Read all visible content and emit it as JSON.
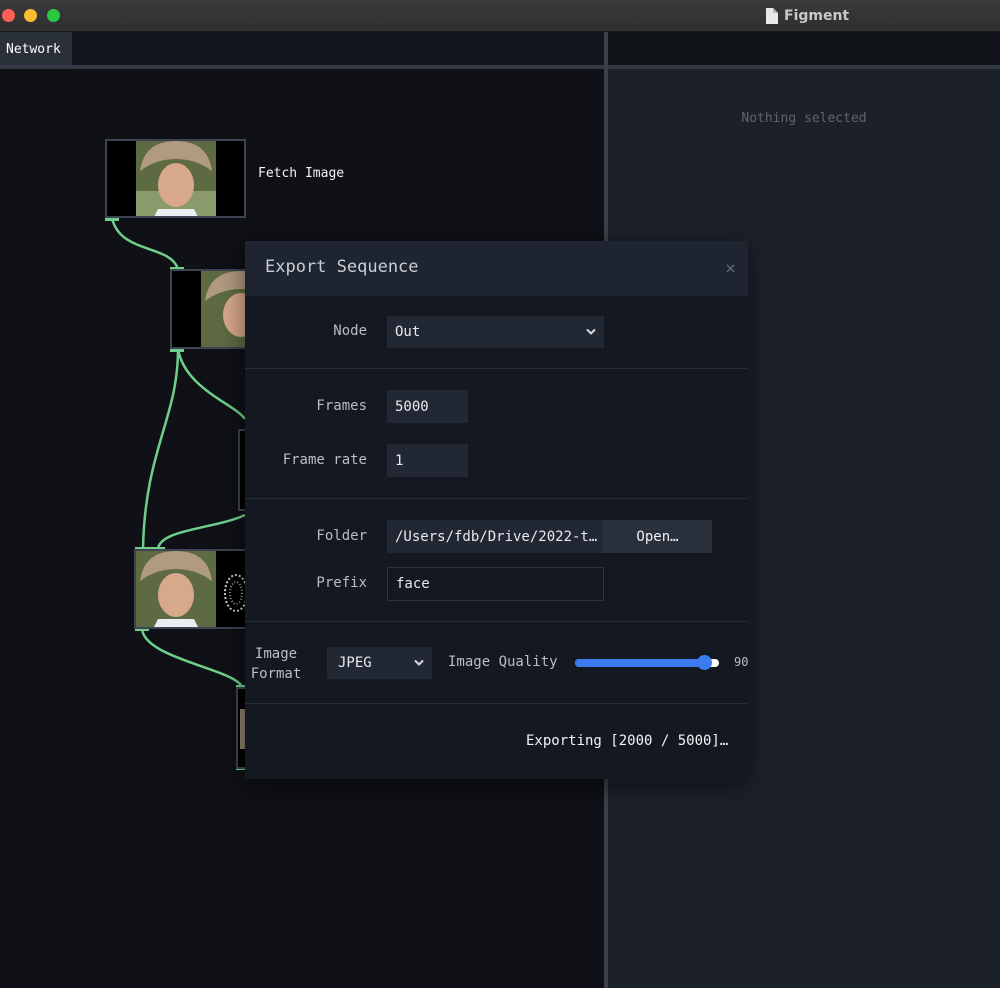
{
  "window": {
    "app_title": "Figment"
  },
  "network_tab": {
    "label": "Network"
  },
  "params_panel": {
    "empty_message": "Nothing selected"
  },
  "nodes": {
    "fetch_label": "Fetch Image"
  },
  "dialog": {
    "title": "Export Sequence",
    "close_glyph": "×",
    "node_label": "Node",
    "node_value": "Out",
    "frames_label": "Frames",
    "frames_value": "5000",
    "frame_rate_label": "Frame rate",
    "frame_rate_value": "1",
    "folder_label": "Folder",
    "folder_value": "/Users/fdb/Drive/2022-t…",
    "open_button": "Open…",
    "prefix_label": "Prefix",
    "prefix_value": "face",
    "image_format_label_line1": "Image",
    "image_format_label_line2": "Format",
    "image_format_value": "JPEG",
    "image_quality_label": "Image Quality",
    "image_quality_value": "90",
    "image_quality_fraction": 0.9,
    "status": "Exporting [2000 / 5000]…"
  },
  "colors": {
    "accent": "#3b7bef",
    "wire": "#6fcf8a",
    "panel_bg": "#1c2028",
    "canvas_bg": "#0f1116"
  },
  "icons": [
    "document-icon",
    "chevron-down-icon",
    "close-icon"
  ]
}
